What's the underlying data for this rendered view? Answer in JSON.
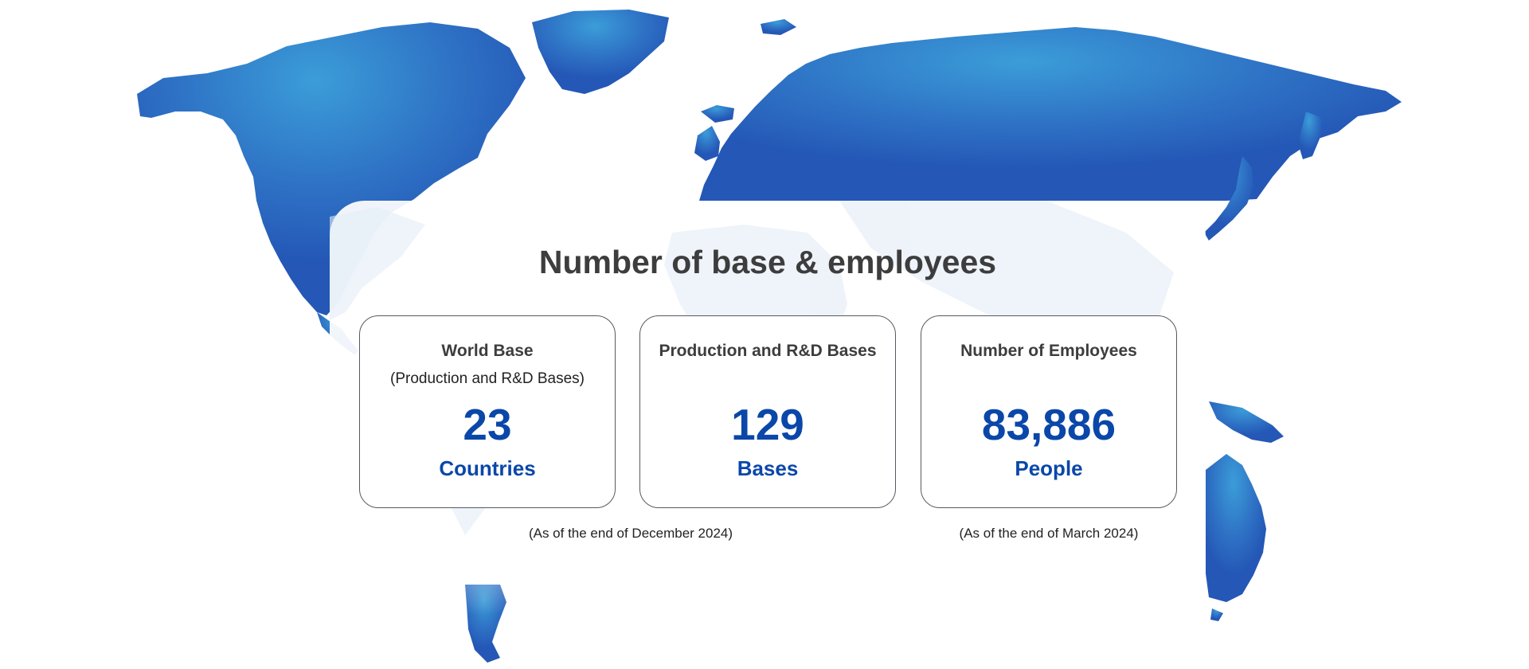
{
  "heading": "Number of base & employees",
  "colors": {
    "map_blue_dark": "#2457b6",
    "map_blue_light": "#3b9dd8",
    "value_blue": "#0a47a9",
    "heading_gray": "#3d3d3d"
  },
  "cards": [
    {
      "title": "World Base",
      "subtitle": "(Production and R&D Bases)",
      "value": "23",
      "unit": "Countries"
    },
    {
      "title": "Production and R&D Bases",
      "subtitle": "",
      "value": "129",
      "unit": "Bases"
    },
    {
      "title": "Number of Employees",
      "subtitle": "",
      "value": "83,886",
      "unit": "People"
    }
  ],
  "notes": {
    "bases_date": "(As of the end of December 2024)",
    "employees_date": "(As of the end of March 2024)"
  }
}
